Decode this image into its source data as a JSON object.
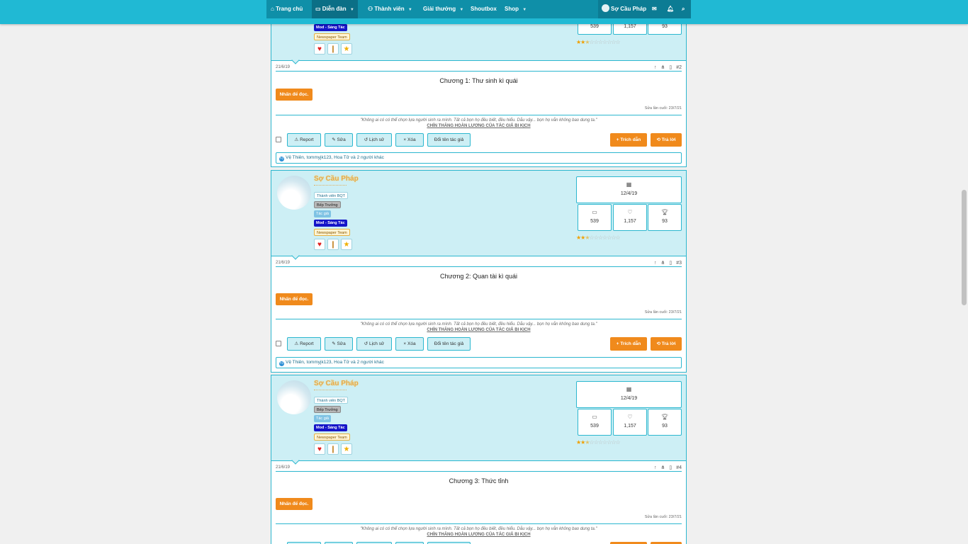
{
  "nav": {
    "items": [
      {
        "label": "Trang chủ",
        "icon": "home-icon",
        "caret": false
      },
      {
        "label": "Diễn đàn",
        "icon": "forum-icon",
        "caret": true,
        "active": true
      },
      {
        "label": "Thành viên",
        "icon": "members-icon",
        "caret": true
      },
      {
        "label": "Giải thưởng",
        "icon": "",
        "caret": true
      },
      {
        "label": "Shoutbox",
        "icon": "",
        "caret": false
      },
      {
        "label": "Shop",
        "icon": "",
        "caret": true
      }
    ],
    "user": "Sợ Cầu Pháp",
    "icons": [
      "mail-icon",
      "bell-icon",
      "search-icon"
    ]
  },
  "user": {
    "name": "Sợ Cầu Pháp",
    "badges": [
      "Thành viên BQT",
      "Bếp Trưởng",
      "Tác giả",
      "Mod - Sáng Tác",
      "Newspaper Team"
    ],
    "trophies": [
      "heart-trophy-icon",
      "pillar-trophy-icon",
      "star-trophy-icon"
    ],
    "joined": "12/4/19",
    "messages": "539",
    "reactions": "1,157",
    "points": "93",
    "rating_filled": 2.5,
    "rating_total": 10,
    "accent": "#2cb7cf"
  },
  "signature": {
    "quote": "\"Không ai có có thể chọn lựa người sinh ra mình. Tất cả bọn họ đều biết, đều hiểu. Dẫu vậy... bọn họ vẫn không bao dung ta.\"",
    "title": "CHÍN THĂNG HOÀN LƯƠNG CỦA TÁC GIẢ BI KỊCH"
  },
  "labels": {
    "read": "Nhấn để đọc.",
    "edited": "Sửa lần cuối: 23/7/21",
    "report": "Report",
    "edit": "Sửa",
    "history": "Lịch sử",
    "delete": "Xóa",
    "rename": "Đổi tên tác giả",
    "quote": "+ Trích dẫn",
    "reply": "Trả lời",
    "likes": "Vệ Thiên, tommyjk123, Hoa Tử và 2 người khác"
  },
  "posts": [
    {
      "date": "21/6/19",
      "num": "#2",
      "title": "Chương 1: Thư sinh kì quái"
    },
    {
      "date": "21/6/19",
      "num": "#3",
      "title": "Chương 2: Quan tài kì quái"
    },
    {
      "date": "21/6/19",
      "num": "#4",
      "title": "Chương 3: Thức tỉnh"
    }
  ]
}
